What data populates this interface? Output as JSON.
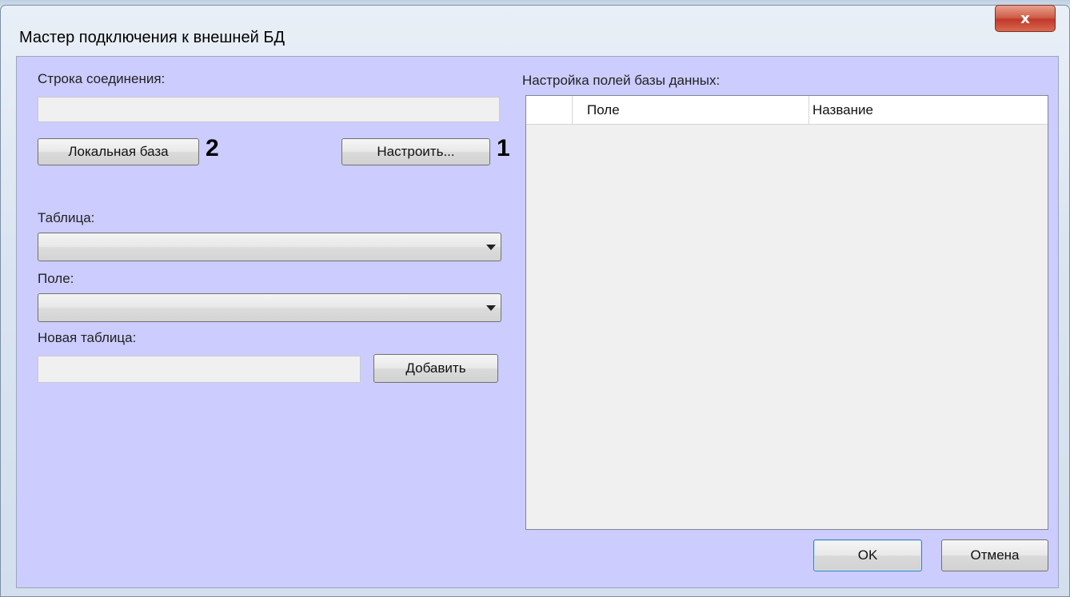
{
  "window": {
    "title": "Мастер подключения к внешней БД",
    "close_glyph": "x"
  },
  "left": {
    "connection_label": "Строка соединения:",
    "connection_value": "",
    "local_db_button": "Локальная база",
    "local_db_marker": "2",
    "configure_button": "Настроить...",
    "configure_marker": "1",
    "table_label": "Таблица:",
    "table_value": "",
    "field_label": "Поле:",
    "field_value": "",
    "new_table_label": "Новая таблица:",
    "new_table_value": "",
    "add_button": "Добавить"
  },
  "right": {
    "fields_label": "Настройка полей базы данных:",
    "columns": [
      "Поле",
      "Название"
    ],
    "rows": []
  },
  "footer": {
    "ok_button": "OK",
    "cancel_button": "Отмена"
  },
  "colors": {
    "client_bg": "#ccccff",
    "close_button": "#c0392b",
    "default_button_border": "#3c7fb1"
  }
}
